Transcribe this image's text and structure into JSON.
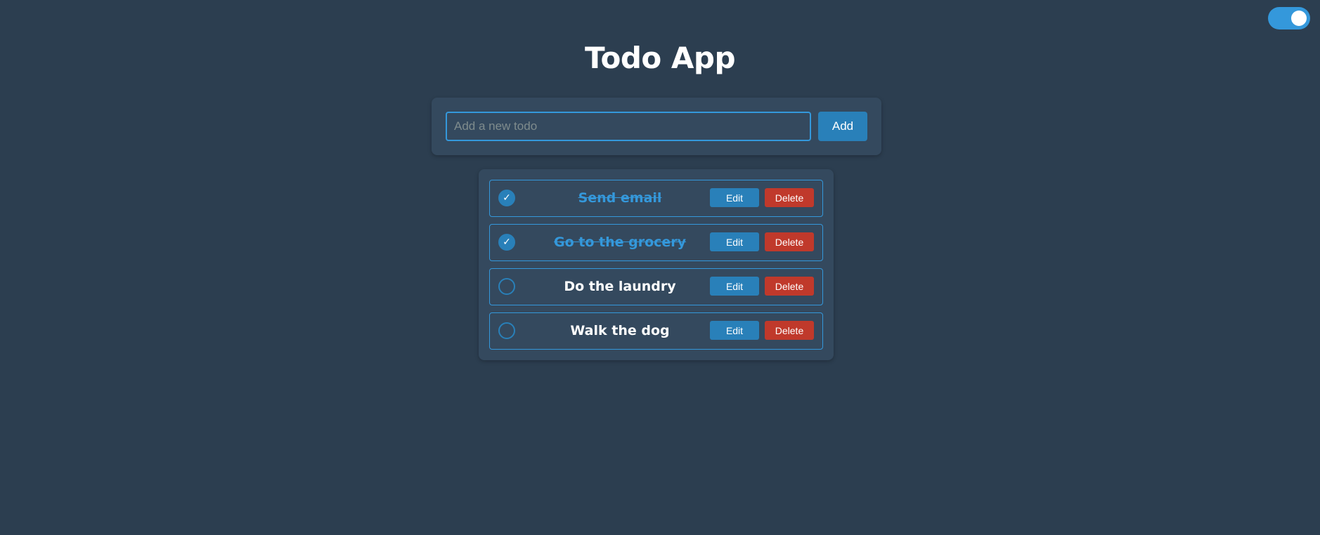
{
  "theme_toggle": {
    "state": "on",
    "accent_color": "#3498db"
  },
  "header": {
    "title": "Todo App"
  },
  "add_form": {
    "placeholder": "Add a new todo",
    "value": "",
    "add_label": "Add"
  },
  "todos": [
    {
      "text": "Send email",
      "completed": true,
      "edit_label": "Edit",
      "delete_label": "Delete"
    },
    {
      "text": "Go to the grocery",
      "completed": true,
      "edit_label": "Edit",
      "delete_label": "Delete"
    },
    {
      "text": "Do the laundry",
      "completed": false,
      "edit_label": "Edit",
      "delete_label": "Delete"
    },
    {
      "text": "Walk the dog",
      "completed": false,
      "edit_label": "Edit",
      "delete_label": "Delete"
    }
  ],
  "colors": {
    "background": "#2c3e50",
    "panel": "#34495e",
    "primary": "#2980b9",
    "danger": "#c0392b",
    "completed_text": "#3498db"
  }
}
